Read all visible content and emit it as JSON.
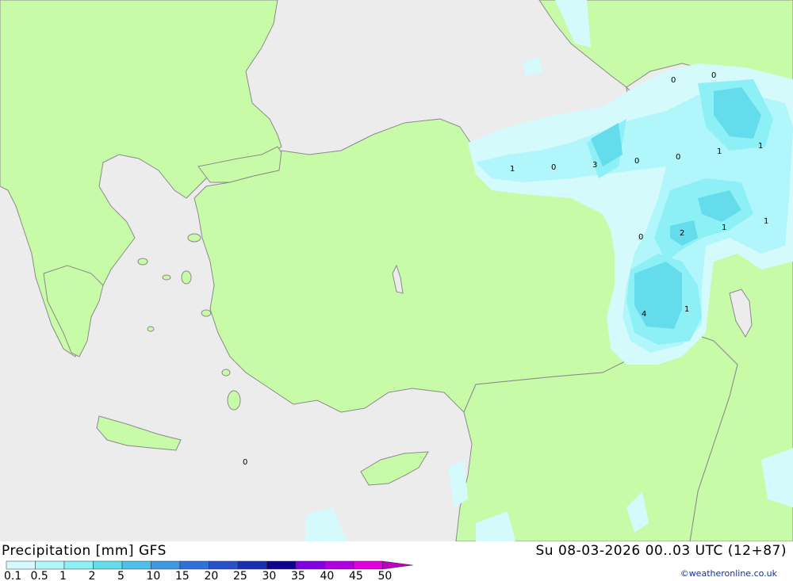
{
  "title": "Precipitation [mm] GFS",
  "datetime": "Su 08-03-2026 00..03 UTC (12+87)",
  "credit": "©weatheronline.co.uk",
  "colors": {
    "sea": "#ececec",
    "land": "#c8fba8",
    "border": "#8a8a8a"
  },
  "legend": {
    "values": [
      "0.1",
      "0.5",
      "1",
      "2",
      "5",
      "10",
      "15",
      "20",
      "25",
      "30",
      "35",
      "40",
      "45",
      "50"
    ],
    "colors": [
      "#d4fafc",
      "#b0f6fa",
      "#8cf0f6",
      "#64dcec",
      "#4cc0e8",
      "#3c98e0",
      "#3070d8",
      "#2850c8",
      "#1830b0",
      "#100090",
      "#8000e0",
      "#b000e0",
      "#e000e0",
      "#c000c0"
    ]
  },
  "contour_labels": [
    "0",
    "0",
    "1",
    "0",
    "3",
    "0",
    "0",
    "1",
    "1",
    "1",
    "0",
    "2",
    "1",
    "4",
    "1",
    "0"
  ]
}
